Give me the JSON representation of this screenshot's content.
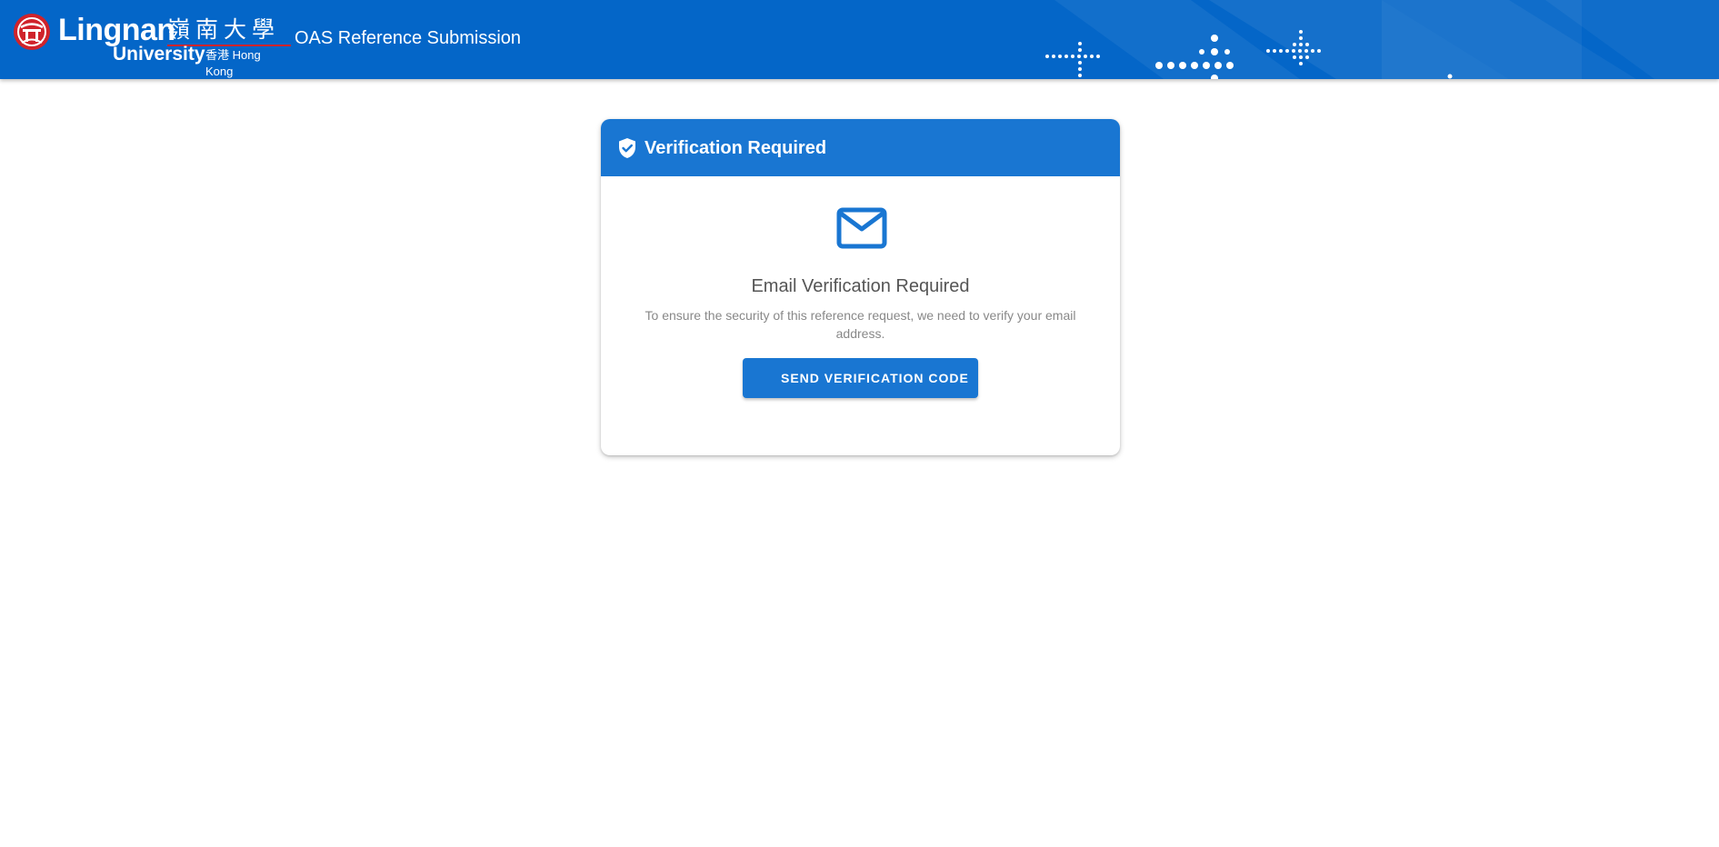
{
  "header": {
    "logo": {
      "name_en": "Lingnan",
      "name_zh": "嶺南大學",
      "sub_en": "University",
      "sub_location": "香港 Hong Kong",
      "emblem_icon": "lingnan-university-emblem"
    },
    "app_title": "OAS Reference Submission",
    "colors": {
      "background": "#0466c8",
      "accent_red": "#d0232b"
    }
  },
  "card": {
    "header": {
      "icon": "shield-check-icon",
      "title": "Verification Required",
      "background": "#1976d2"
    },
    "icon": "email-icon",
    "subtitle": "Email Verification Required",
    "description": "To ensure the security of this reference request, we need to verify your email address.",
    "button_label": "SEND VERIFICATION CODE",
    "button_color": "#1976d2"
  }
}
